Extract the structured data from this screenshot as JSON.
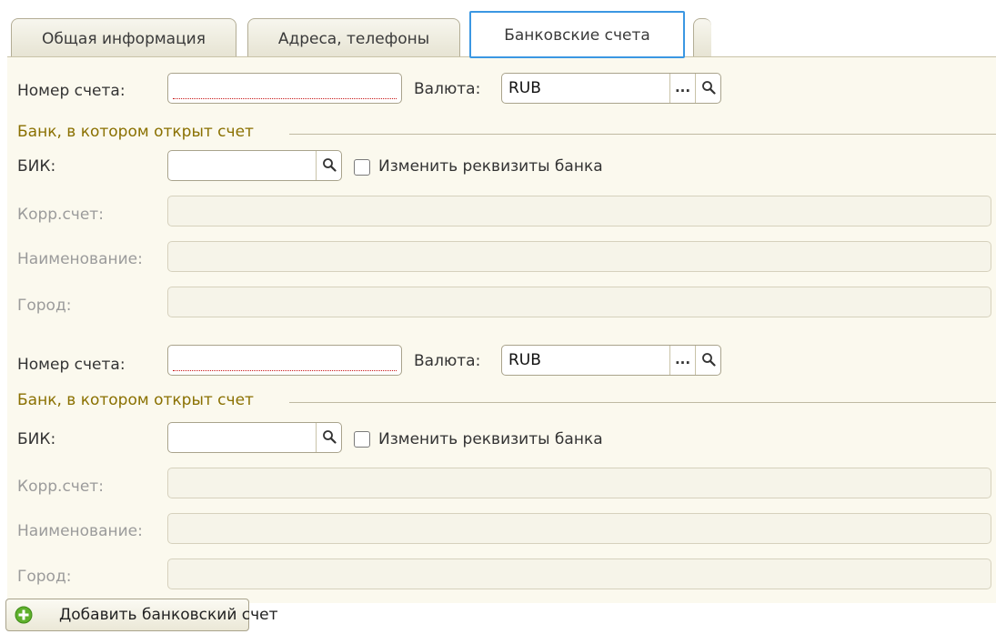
{
  "tabs": [
    {
      "label": "Общая информация"
    },
    {
      "label": "Адреса, телефоны"
    },
    {
      "label": "Банковские счета",
      "active": true
    }
  ],
  "accounts": [
    {
      "account_number_label": "Номер счета:",
      "account_number_value": "",
      "currency_label": "Валюта:",
      "currency_value": "RUB",
      "bank_group_title": "Банк, в котором открыт счет",
      "bik_label": "БИК:",
      "bik_value": "",
      "change_bank_details_label": "Изменить реквизиты банка",
      "change_bank_details_checked": false,
      "corr_account_label": "Корр.счет:",
      "name_label": "Наименование:",
      "city_label": "Город:"
    },
    {
      "account_number_label": "Номер счета:",
      "account_number_value": "",
      "currency_label": "Валюта:",
      "currency_value": "RUB",
      "bank_group_title": "Банк, в котором открыт счет",
      "bik_label": "БИК:",
      "bik_value": "",
      "change_bank_details_label": "Изменить реквизиты банка",
      "change_bank_details_checked": false,
      "corr_account_label": "Корр.счет:",
      "name_label": "Наименование:",
      "city_label": "Город:"
    }
  ],
  "add_account_button": {
    "label": "Добавить банковский счет",
    "icon": "plus-circle-icon"
  },
  "icons": {
    "select": "ellipsis-icon",
    "search": "magnifier-icon"
  },
  "colors": {
    "panel_background": "#fbf9ee",
    "active_tab_border": "#3b97e2",
    "group_title": "#8a7000",
    "required_underline": "#c81818",
    "add_icon": "#5fb02c"
  }
}
